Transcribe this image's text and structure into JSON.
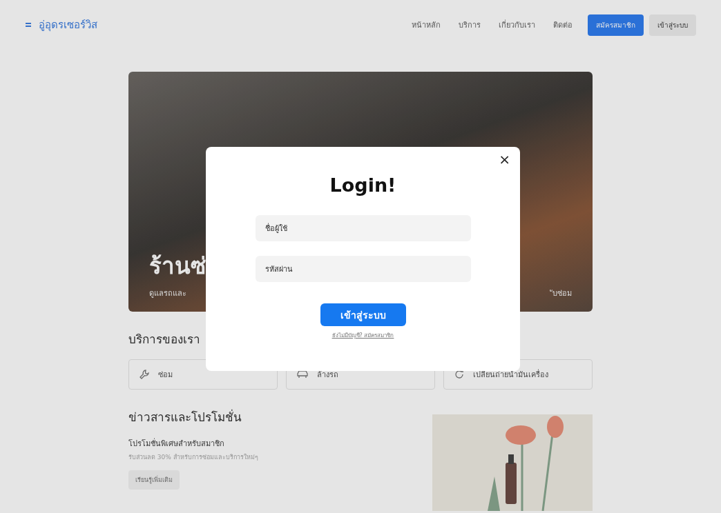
{
  "header": {
    "logo": "อู่อุดรเซอร์วิส",
    "nav": [
      {
        "label": "หน้าหลัก",
        "kind": "link"
      },
      {
        "label": "บริการ",
        "kind": "link"
      },
      {
        "label": "เกี่ยวกับเรา",
        "kind": "link"
      },
      {
        "label": "ติดต่อ",
        "kind": "link"
      },
      {
        "label": "สมัครสมาชิก",
        "kind": "primary"
      },
      {
        "label": "เข้าสู่ระบบ",
        "kind": "secondary"
      }
    ]
  },
  "hero": {
    "title": "ร้านซ่",
    "subtitle_left": "ดูแลรถและ",
    "subtitle_right": "ับซ่อม"
  },
  "services": {
    "title": "บริการของเรา",
    "items": [
      {
        "label": "ซ่อม",
        "kind": "repair"
      },
      {
        "label": "ล้างรถ",
        "kind": "wash"
      },
      {
        "label": "เปลี่ยนถ่ายน้ำมันเครื่อง",
        "kind": "oil"
      }
    ]
  },
  "news": {
    "title": "ข่าวสารและโปรโมชั่น",
    "promo_title": "โปรโมชั่นพิเศษสำหรับสมาชิก",
    "promo_text": "รับส่วนลด 30% สำหรับการซ่อมและบริการใหม่ๆ",
    "button": "เรียนรู้เพิ่มเติม"
  },
  "login_modal": {
    "close": "×",
    "title": "Login!",
    "fields": [
      {
        "placeholder": "ชื่อผู้ใช้"
      },
      {
        "placeholder": "รหัสผ่าน"
      }
    ],
    "submit": "เข้าสู่ระบบ",
    "register_link": "ยังไม่มีบัญชี? สมัครสมาชิก"
  }
}
